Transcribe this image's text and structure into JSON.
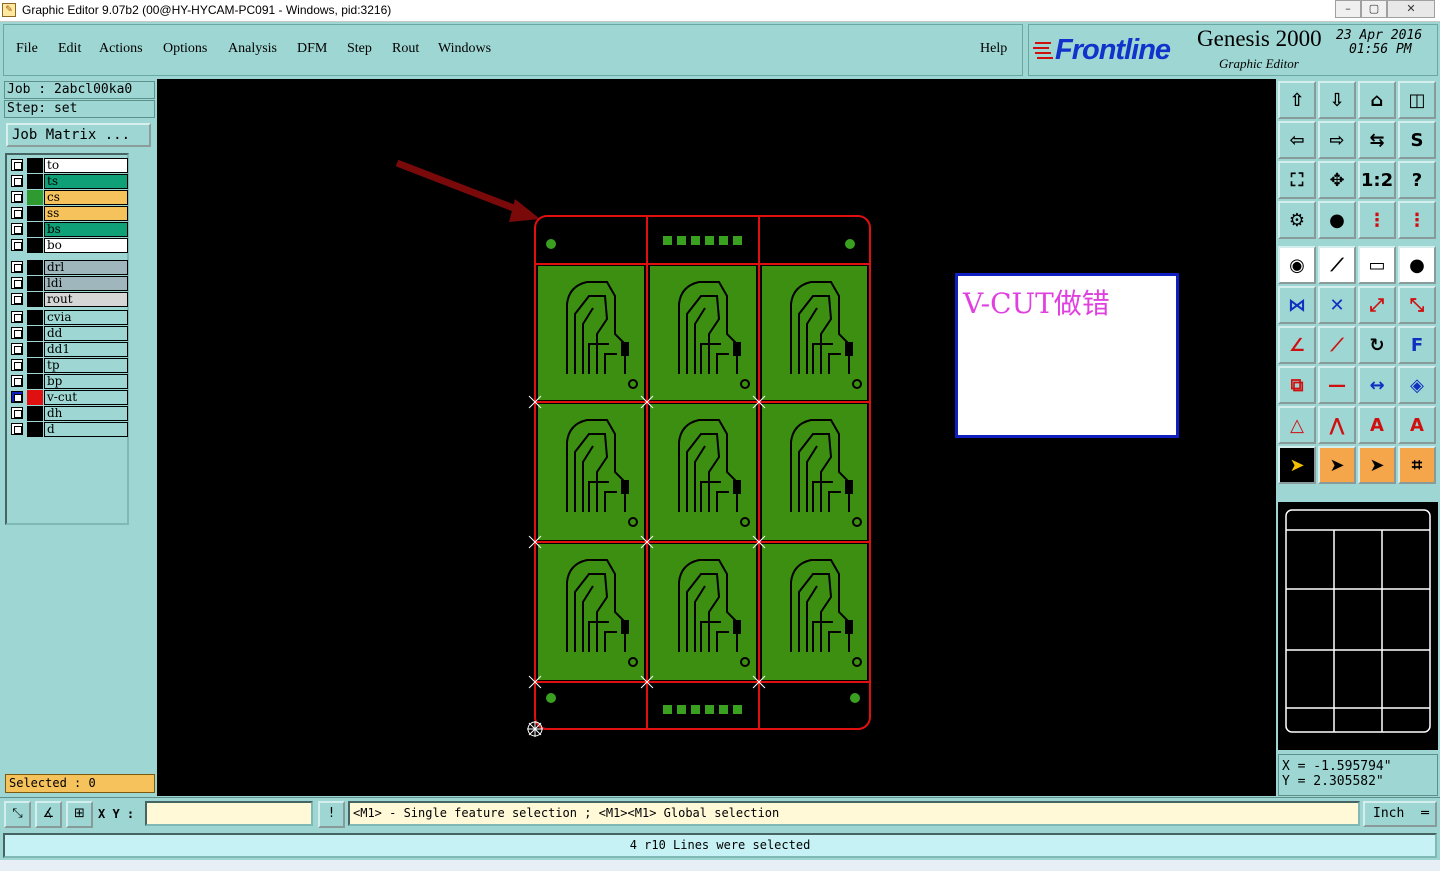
{
  "window": {
    "title": "Graphic Editor 9.07b2 (00@HY-HYCAM-PC091 - Windows, pid:3216)",
    "minimize_glyph": "–",
    "maximize_glyph": "▢",
    "close_glyph": "✕"
  },
  "menu": {
    "items": [
      "File",
      "Edit",
      "Actions",
      "Options",
      "Analysis",
      "DFM",
      "Step",
      "Rout",
      "Windows"
    ],
    "help": "Help"
  },
  "branding": {
    "logo": "Frontline",
    "product": "Genesis 2000",
    "subtitle": "Graphic Editor",
    "date": "23 Apr 2016",
    "time": "01:56 PM"
  },
  "job": {
    "job_line": "Job : 2abcl00ka0",
    "step_line": "Step: set",
    "matrix_button": "Job Matrix ..."
  },
  "layers": [
    {
      "name": "to",
      "bg": "#ffffff",
      "color": "#000000",
      "group": 0
    },
    {
      "name": "ts",
      "bg": "#10a078",
      "color": "#000000",
      "group": 0
    },
    {
      "name": "cs",
      "bg": "#f6c25c",
      "color": "#2f9a2f",
      "group": 0
    },
    {
      "name": "ss",
      "bg": "#f6c25c",
      "color": "#000000",
      "group": 0
    },
    {
      "name": "bs",
      "bg": "#10a078",
      "color": "#000000",
      "group": 0
    },
    {
      "name": "bo",
      "bg": "#ffffff",
      "color": "#000000",
      "group": 0
    },
    {
      "name": "drl",
      "bg": "#9fb6bc",
      "color": "#000000",
      "group": 1
    },
    {
      "name": "ldi",
      "bg": "#9fb6bc",
      "color": "#000000",
      "group": 1
    },
    {
      "name": "rout",
      "bg": "#d6d6d6",
      "color": "#000000",
      "group": 1
    },
    {
      "name": "cvia",
      "bg": "#9dd6d2",
      "color": "#000000",
      "group": 2
    },
    {
      "name": "dd",
      "bg": "#9dd6d2",
      "color": "#000000",
      "group": 2
    },
    {
      "name": "dd1",
      "bg": "#9dd6d2",
      "color": "#000000",
      "group": 2
    },
    {
      "name": "tp",
      "bg": "#9dd6d2",
      "color": "#000000",
      "group": 2
    },
    {
      "name": "bp",
      "bg": "#9dd6d2",
      "color": "#000000",
      "group": 2
    },
    {
      "name": "v-cut",
      "bg": "#9dd6d2",
      "color": "#e01010",
      "group": 2,
      "active": true
    },
    {
      "name": "dh",
      "bg": "#9dd6d2",
      "color": "#000000",
      "group": 2
    },
    {
      "name": "d",
      "bg": "#9dd6d2",
      "color": "#000000",
      "group": 2
    }
  ],
  "selected": "Selected : 0",
  "annotation": "V-CUT做错",
  "coords": {
    "x": "X = -1.595794\"",
    "y": "Y = 2.305582\""
  },
  "bottom": {
    "xy_label": "X Y :",
    "xy_value": "",
    "prompt": "<M1> - Single feature selection ; <M1><M1> Global selection",
    "unit": "Inch",
    "status": "4 r10 Lines were selected"
  },
  "colors": {
    "panel": "#9dd6d2",
    "board_green": "#3d8f12",
    "outline_red": "#e01010",
    "arrow": "#7a0a0a"
  }
}
